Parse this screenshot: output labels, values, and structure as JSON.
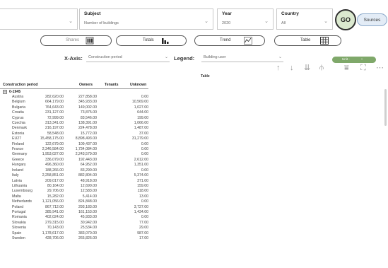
{
  "filters": [
    {
      "label": "",
      "value": ""
    },
    {
      "label": "Subject",
      "value": "Number of buildings"
    },
    {
      "label": "Year",
      "value": "2020"
    },
    {
      "label": "Country",
      "value": "All"
    }
  ],
  "go_label": "GO",
  "sources_label": "Sources",
  "toggles": {
    "shares": "Shares",
    "totals": "Totals",
    "trend": "Trend",
    "table": "Table"
  },
  "xaxis": {
    "label": "X-Axis:",
    "value": "Construction period"
  },
  "legend": {
    "label": "Legend:",
    "value": "Building user"
  },
  "unit": {
    "value": "Unit -"
  },
  "visual_title": "Table",
  "table": {
    "headers": [
      "Construction period",
      "Owners",
      "Tenants",
      "Unknown"
    ],
    "group": {
      "toggle": "⊟",
      "label": "0-1945"
    },
    "rows": [
      [
        "Austria",
        "282,620.00",
        "227,858.00",
        "0.00"
      ],
      [
        "Belgium",
        "664,179.00",
        "345,933.00",
        "10,569.00"
      ],
      [
        "Bulgaria",
        "764,643.00",
        "149,002.00",
        "1,027.00"
      ],
      [
        "Croatia",
        "231,127.00",
        "73,875.00",
        "644.00"
      ],
      [
        "Cyprus",
        "72,999.00",
        "83,546.00",
        "199.00"
      ],
      [
        "Czechia",
        "313,341.00",
        "138,391.00",
        "1,066.00"
      ],
      [
        "Denmark",
        "216,197.00",
        "224,478.00",
        "1,487.00"
      ],
      [
        "Estonia",
        "58,548.00",
        "15,772.00",
        "37.00"
      ],
      [
        "EU27",
        "15,458,175.00",
        "8,898,493.00",
        "31,279.00"
      ],
      [
        "Finland",
        "122,679.00",
        "109,437.00",
        "0.00"
      ],
      [
        "France",
        "2,346,584.00",
        "1,734,084.00",
        "0.00"
      ],
      [
        "Germany",
        "1,953,027.00",
        "2,243,579.00",
        "0.00"
      ],
      [
        "Greece",
        "336,079.00",
        "192,443.00",
        "2,612.00"
      ],
      [
        "Hungary",
        "496,360.00",
        "64,952.00",
        "1,351.00"
      ],
      [
        "Ireland",
        "188,266.00",
        "83,290.00",
        "0.00"
      ],
      [
        "Italy",
        "2,258,851.00",
        "882,804.00",
        "5,374.00"
      ],
      [
        "Latvia",
        "209,017.00",
        "48,918.00",
        "371.00"
      ],
      [
        "Lithuania",
        "80,164.00",
        "12,690.00",
        "159.00"
      ],
      [
        "Luxembourg",
        "29,706.00",
        "12,583.00",
        "118.00"
      ],
      [
        "Malta",
        "15,282.00",
        "5,414.00",
        "13.00"
      ],
      [
        "Netherlands",
        "1,121,056.00",
        "824,848.00",
        "0.00"
      ],
      [
        "Poland",
        "867,712.00",
        "293,183.00",
        "3,727.00"
      ],
      [
        "Portugal",
        "385,941.00",
        "161,153.00",
        "1,434.00"
      ],
      [
        "Romania",
        "402,024.00",
        "45,933.00",
        "0.00"
      ],
      [
        "Slovakia",
        "279,315.00",
        "30,942.00",
        "77.00"
      ],
      [
        "Slovenia",
        "70,143.00",
        "25,534.00",
        "29.00"
      ],
      [
        "Spain",
        "1,178,617.00",
        "383,070.00",
        "987.00"
      ],
      [
        "Sweden",
        "428,706.00",
        "265,826.00",
        "17.00"
      ]
    ]
  },
  "colors": {
    "go_bg": "#dbe9cf",
    "sources_bg": "#e3ecf6",
    "unit_bg": "#7fa86a"
  }
}
